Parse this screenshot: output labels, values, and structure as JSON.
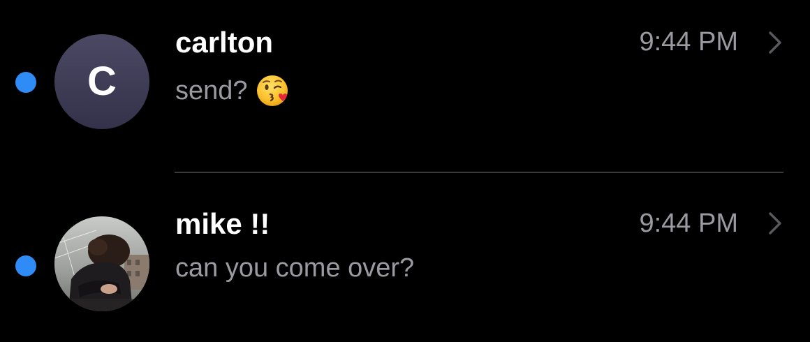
{
  "conversations": [
    {
      "name": "carlton",
      "avatar_initial": "C",
      "preview": "send?",
      "preview_emoji": "face-blowing-a-kiss-icon",
      "time": "9:44 PM",
      "unread": true
    },
    {
      "name": "mike !!",
      "avatar_initial": "",
      "preview": "can you come over?",
      "time": "9:44 PM",
      "unread": true
    }
  ],
  "colors": {
    "unread_dot": "#2f8cf6",
    "secondary_text": "#9a9aa0",
    "separator": "#3a3a3c",
    "background": "#000000"
  }
}
